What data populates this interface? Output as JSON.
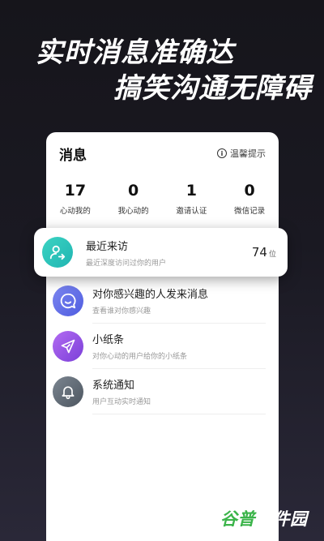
{
  "promo": {
    "line1": "实时消息准确达",
    "line2": "搞笑沟通无障碍"
  },
  "card": {
    "title": "消息",
    "tip_icon": "i",
    "tip_label": "温馨提示"
  },
  "stats": [
    {
      "value": "17",
      "label": "心动我的"
    },
    {
      "value": "0",
      "label": "我心动的"
    },
    {
      "value": "1",
      "label": "邀请认证"
    },
    {
      "value": "0",
      "label": "微信记录"
    }
  ],
  "highlight": {
    "icon": "user-arrow-icon",
    "title": "最近来访",
    "subtitle": "最近深度访问过你的用户",
    "count": "74",
    "count_unit": "位",
    "color": "#2fc4bb"
  },
  "items": [
    {
      "icon": "smile-chat-icon",
      "title": "对你感兴趣的人发来消息",
      "subtitle": "查看谁对你感兴趣",
      "color": "#5f6de6"
    },
    {
      "icon": "paper-plane-icon",
      "title": "小纸条",
      "subtitle": "对你心动的用户给你的小纸条",
      "color": "#9a55e8"
    },
    {
      "icon": "bell-icon",
      "title": "系统通知",
      "subtitle": "用户互动实时通知",
      "color": "#5f6872"
    }
  ],
  "watermark": {
    "part1": "谷普",
    "part2": "软件园"
  }
}
